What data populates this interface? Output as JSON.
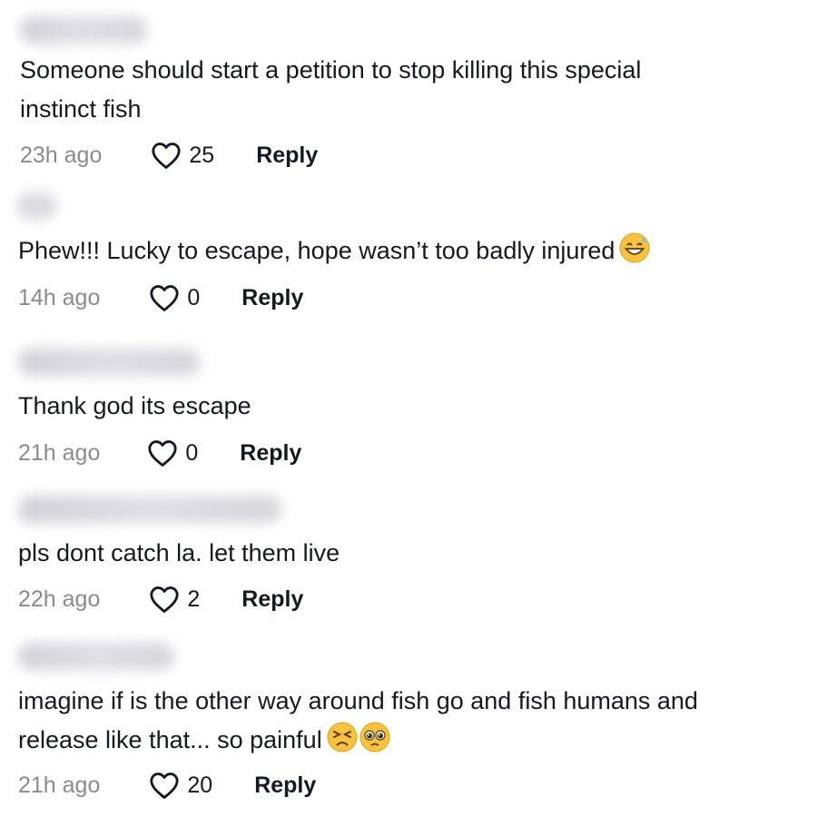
{
  "comments": [
    {
      "text": "Someone should start a petition to stop killing this special\ninstinct fish",
      "time": "23h ago",
      "likes": "25",
      "reply": "Reply"
    },
    {
      "text": "Phew!!! Lucky to escape, hope wasn’t too badly injured",
      "time": "14h ago",
      "likes": "0",
      "reply": "Reply",
      "emojis": [
        "grinning-sweat-emoji"
      ]
    },
    {
      "text": "Thank god its escape",
      "time": "21h ago",
      "likes": "0",
      "reply": "Reply"
    },
    {
      "text": "pls dont catch la. let them live",
      "time": "22h ago",
      "likes": "2",
      "reply": "Reply"
    },
    {
      "text": "imagine if is the other way around fish go and fish humans and\nrelease like that... so painful",
      "time": "21h ago",
      "likes": "20",
      "reply": "Reply",
      "emojis": [
        "persevering-face-emoji",
        "pleading-face-emoji"
      ]
    }
  ],
  "icons": {
    "like": "heart-outline-icon"
  },
  "colors": {
    "text": "#161823",
    "muted": "#8a8b91",
    "emoji": "#f7c33e"
  }
}
